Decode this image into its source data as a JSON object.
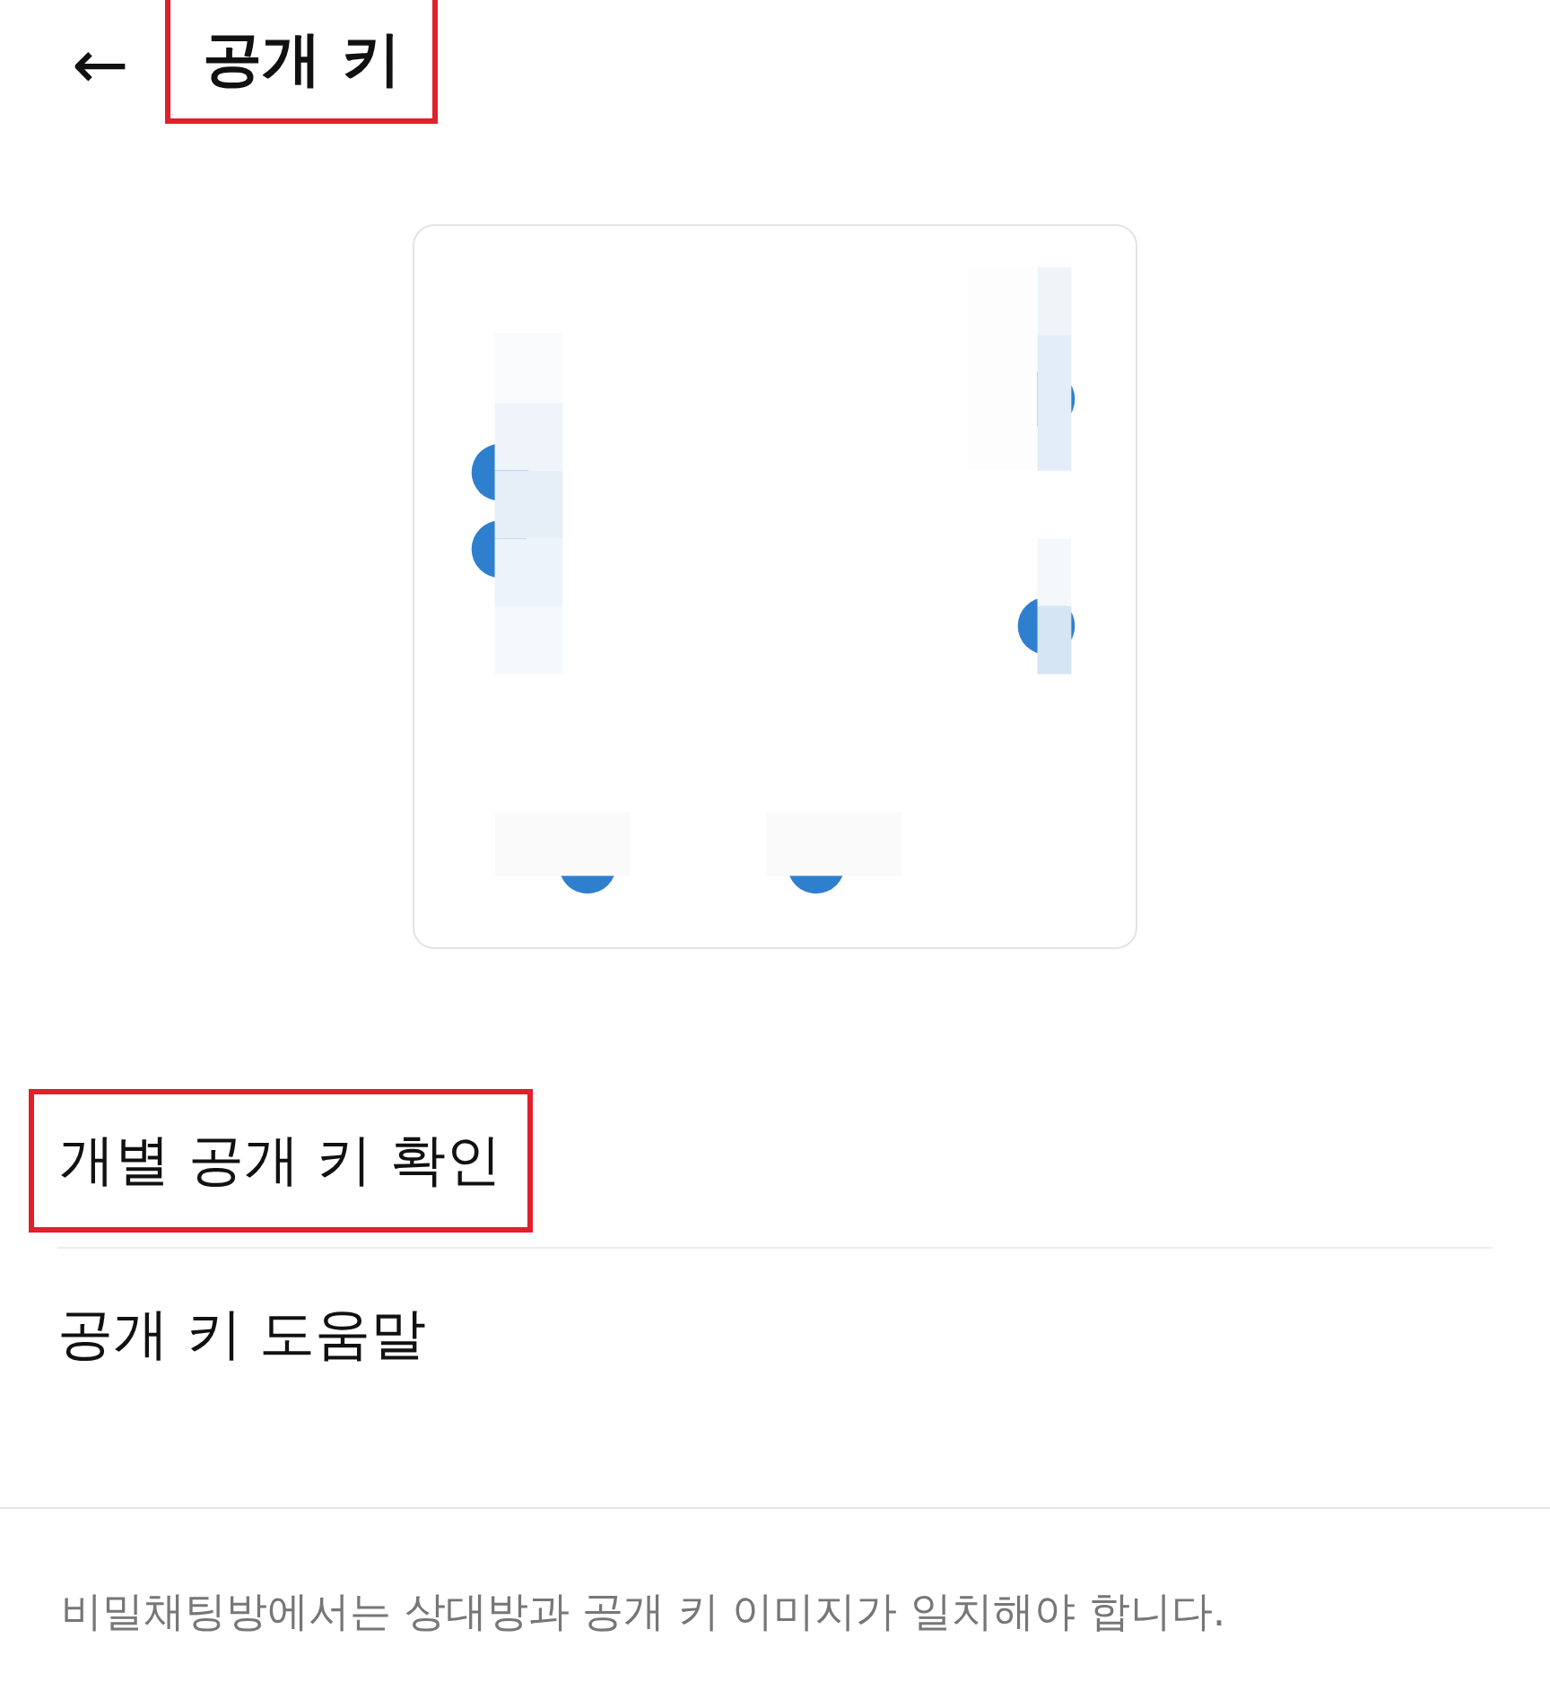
{
  "header": {
    "back": "←",
    "title": "공개 키",
    "highlighted": true
  },
  "menu_items": [
    {
      "label": "개별 공개 키 확인",
      "highlighted": true
    },
    {
      "label": "공개 키 도움말",
      "highlighted": false
    }
  ],
  "footer_note": "비밀채팅방에서는 상대방과 공개 키 이미지가 일치해야 합니다."
}
